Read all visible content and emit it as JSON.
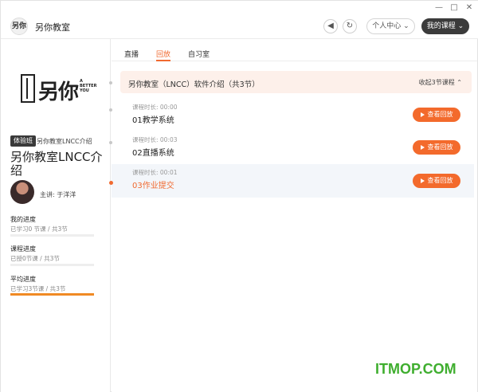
{
  "app": {
    "logo_text": "另你",
    "title": "另你教室",
    "window_controls": [
      "—",
      "□",
      "✕"
    ]
  },
  "header": {
    "back_icon": "◀",
    "refresh_icon": "↻",
    "personal_center": "个人中心 ⌄",
    "my_courses": "我的课程 ⌄"
  },
  "sidebar": {
    "brand_text": "另你",
    "brand_sub": "A BETTER YOU",
    "badge": "体验班",
    "badge_text": "另你教室LNCC介绍",
    "course_title": "另你教室LNCC介绍",
    "teacher": "主讲: 于洋洋",
    "progress": [
      {
        "label": "我的进度",
        "sub": "已学习0 节课 / 共3节",
        "value": 0
      },
      {
        "label": "课程进度",
        "sub": "已授0节课 / 共3节",
        "value": 0
      },
      {
        "label": "平均进度",
        "sub": "已学习3节课 / 共3节",
        "value": 1
      }
    ]
  },
  "tabs": [
    {
      "label": "直播",
      "active": false
    },
    {
      "label": "回放",
      "active": true
    },
    {
      "label": "自习室",
      "active": false
    }
  ],
  "section": {
    "title": "另你教室（LNCC）软件介绍（共3节）",
    "toggle": "收起3节课程 ⌃"
  },
  "lessons": [
    {
      "duration": "课程时长: 00:00",
      "name": "01教学系统",
      "button": "查看回放",
      "active": false
    },
    {
      "duration": "课程时长: 00:03",
      "name": "02直播系统",
      "button": "查看回放",
      "active": false
    },
    {
      "duration": "课程时长: 00:01",
      "name": "03作业提交",
      "button": "查看回放",
      "active": true
    }
  ],
  "watermark": "ITMOP.COM",
  "colors": {
    "accent": "#f36a2c",
    "dark": "#3b3b3b",
    "progress": "#f08a24"
  }
}
